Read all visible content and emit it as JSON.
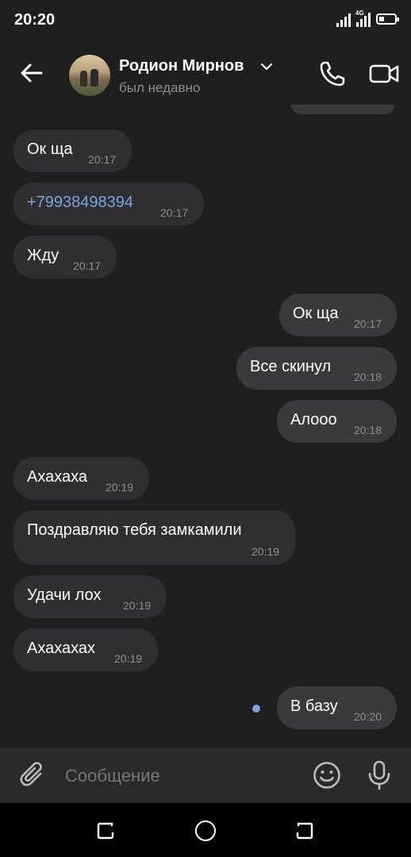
{
  "status_bar": {
    "time": "20:20",
    "network": "4G"
  },
  "header": {
    "contact_name": "Родион Мирнов",
    "status": "был недавно"
  },
  "messages": [
    {
      "dir": "in",
      "text": "Ок ща",
      "time": "20:17"
    },
    {
      "dir": "in",
      "text": "+79938498394",
      "time": "20:17",
      "link": true
    },
    {
      "dir": "in",
      "text": "Жду",
      "time": "20:17"
    },
    {
      "dir": "out",
      "text": "Ок ща",
      "time": "20:17"
    },
    {
      "dir": "out",
      "text": "Все скинул",
      "time": "20:18"
    },
    {
      "dir": "out",
      "text": "Алооо",
      "time": "20:18"
    },
    {
      "dir": "in",
      "text": "Ахахаха",
      "time": "20:19"
    },
    {
      "dir": "in",
      "text": "Поздравляю тебя замкамили",
      "time": "20:19"
    },
    {
      "dir": "in",
      "text": "Удачи лох",
      "time": "20:19"
    },
    {
      "dir": "in",
      "text": "Ахахахах",
      "time": "20:19"
    },
    {
      "dir": "out",
      "text": "В базу",
      "time": "20:20",
      "unread": true
    }
  ],
  "input": {
    "placeholder": "Сообщение"
  },
  "colors": {
    "background": "#1f1f1f",
    "bubble_in": "#2f2f31",
    "bubble_out": "#3a3a3c",
    "link": "#7aa6e0",
    "muted": "#8e8e8e"
  },
  "icons": [
    "back-arrow-icon",
    "chevron-down-icon",
    "phone-icon",
    "video-camera-icon",
    "paperclip-icon",
    "emoji-icon",
    "microphone-icon",
    "nav-recent-icon",
    "nav-home-icon",
    "nav-back-icon"
  ]
}
